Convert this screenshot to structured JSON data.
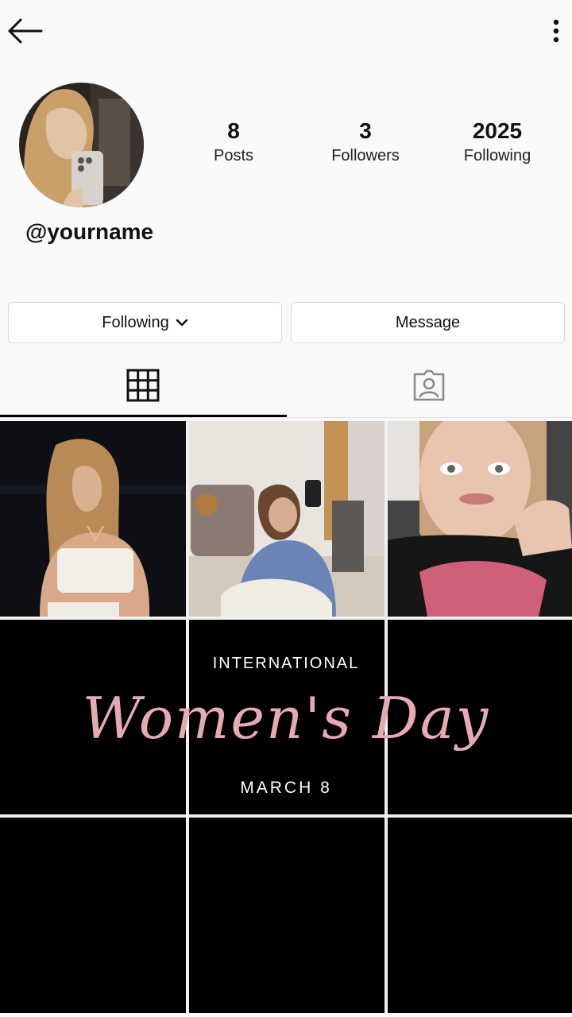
{
  "header": {
    "back_icon": "arrow-left-icon",
    "menu_icon": "more-vertical-icon"
  },
  "profile": {
    "avatar_icon": "profile-photo",
    "username": "@yourname",
    "stats": {
      "posts": {
        "value": "8",
        "label": "Posts"
      },
      "followers": {
        "value": "3",
        "label": "Followers"
      },
      "following": {
        "value": "2025",
        "label": "Following"
      }
    }
  },
  "actions": {
    "following_label": "Following",
    "following_icon": "chevron-down-icon",
    "message_label": "Message"
  },
  "tabs": [
    {
      "name": "grid",
      "icon": "grid-icon",
      "active": true
    },
    {
      "name": "tagged",
      "icon": "tagged-person-icon",
      "active": false
    }
  ],
  "posts": {
    "womens_day": {
      "top": "INTERNATIONAL",
      "script": "Women's Day",
      "bottom": "MARCH 8"
    }
  },
  "colors": {
    "accent_pink": "#e6aab5",
    "post_background": "#000000"
  }
}
